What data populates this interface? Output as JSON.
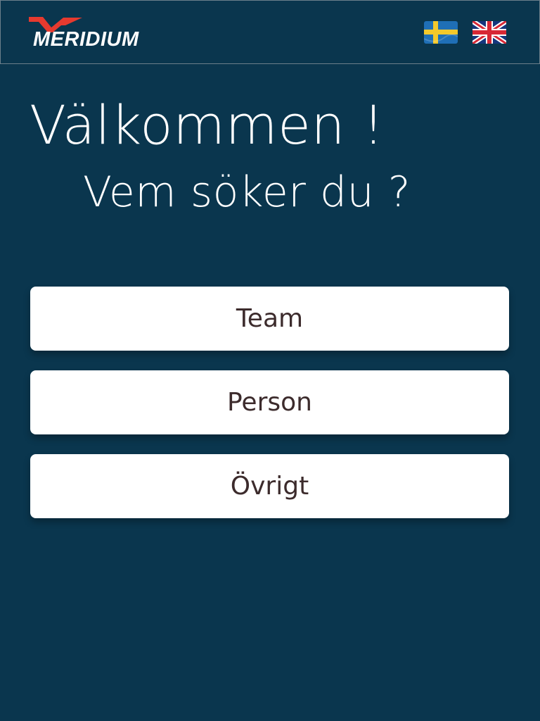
{
  "header": {
    "logo_text": "MERIDIUM",
    "languages": [
      {
        "name": "swedish-flag-icon",
        "code": "sv"
      },
      {
        "name": "uk-flag-icon",
        "code": "en"
      }
    ]
  },
  "main": {
    "welcome": "Välkommen !",
    "question": "Vem söker du ?",
    "options": [
      {
        "label": "Team"
      },
      {
        "label": "Person"
      },
      {
        "label": "Övrigt"
      }
    ]
  },
  "colors": {
    "background": "#0a364e",
    "button_text": "#3c2b2c",
    "logo_red": "#e63a2f"
  }
}
